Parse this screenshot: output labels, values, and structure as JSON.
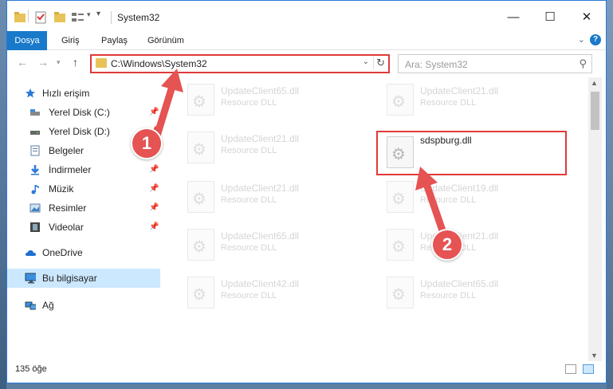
{
  "window": {
    "title": "System32"
  },
  "ribbon": {
    "tabs": [
      {
        "label": "Dosya"
      },
      {
        "label": "Giriş"
      },
      {
        "label": "Paylaş"
      },
      {
        "label": "Görünüm"
      }
    ],
    "help": "?"
  },
  "address": {
    "path": "C:\\Windows\\System32"
  },
  "search": {
    "placeholder": "Ara: System32"
  },
  "sidebar": {
    "items": [
      {
        "label": "Hızlı erişim"
      },
      {
        "label": "Yerel Disk (C:)"
      },
      {
        "label": "Yerel Disk (D:)"
      },
      {
        "label": "Belgeler"
      },
      {
        "label": "İndirmeler"
      },
      {
        "label": "Müzik"
      },
      {
        "label": "Resimler"
      },
      {
        "label": "Videolar"
      },
      {
        "label": "OneDrive"
      },
      {
        "label": "Bu bilgisayar"
      },
      {
        "label": "Ağ"
      }
    ]
  },
  "files": [
    {
      "name": "UpdateClient65.dll",
      "type": "Resource DLL"
    },
    {
      "name": "UpdateClient21.dll",
      "type": "Resource DLL"
    },
    {
      "name": "UpdateClient21.dll",
      "type": "Resource DLL"
    },
    {
      "name": "sdspburg.dll",
      "type": ""
    },
    {
      "name": "UpdateClient21.dll",
      "type": "Resource DLL"
    },
    {
      "name": "UpdateClient19.dll",
      "type": "Resource DLL"
    },
    {
      "name": "UpdateClient65.dll",
      "type": "Resource DLL"
    },
    {
      "name": "UpdateClient21.dll",
      "type": "Resource DLL"
    },
    {
      "name": "UpdateClient42.dll",
      "type": "Resource DLL"
    },
    {
      "name": "UpdateClient65.dll",
      "type": "Resource DLL"
    }
  ],
  "status": {
    "count": "135 öğe"
  },
  "annotations": [
    {
      "label": "1"
    },
    {
      "label": "2"
    }
  ],
  "colors": {
    "accent": "#1979ca",
    "highlight": "#e03a3a",
    "badge": "#e55353"
  }
}
